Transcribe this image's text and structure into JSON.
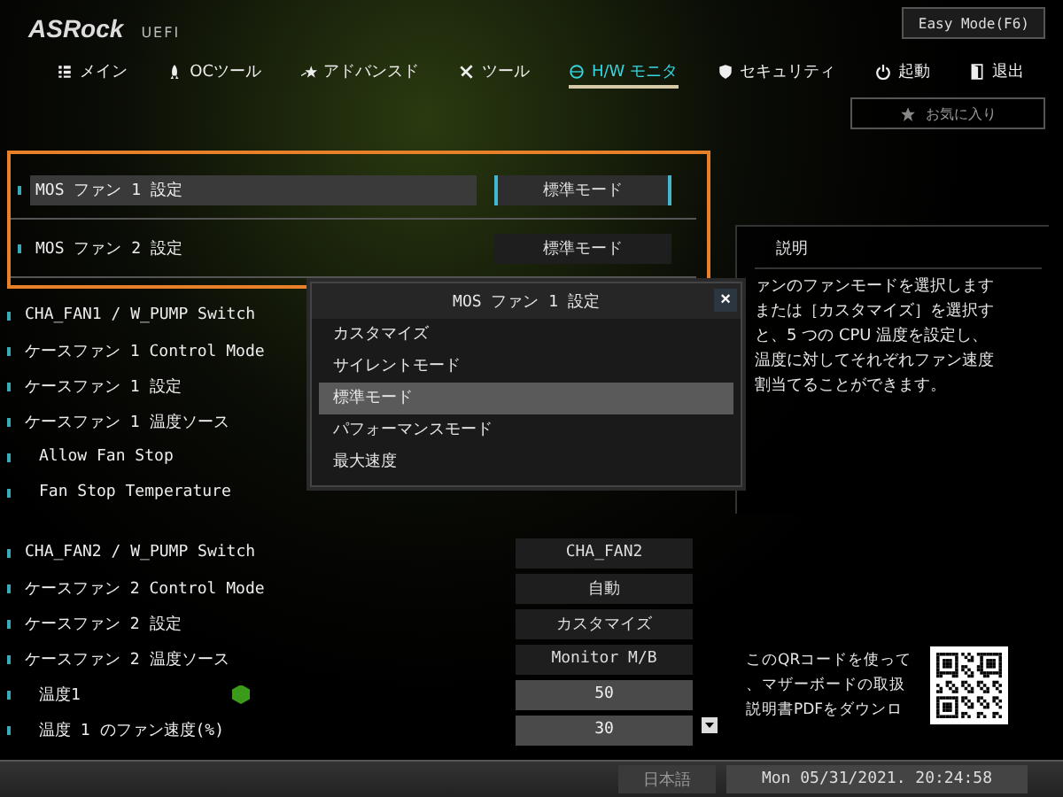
{
  "header": {
    "logo": "ASRock",
    "logo_sub": "UEFI",
    "mode_button": "Easy Mode(F6)"
  },
  "tabs": [
    {
      "label": "メイン",
      "selected": false
    },
    {
      "label": "OCツール",
      "selected": false
    },
    {
      "label": "アドバンスド",
      "selected": false
    },
    {
      "label": "ツール",
      "selected": false
    },
    {
      "label": "H/W モニタ",
      "selected": true
    },
    {
      "label": "セキュリティ",
      "selected": false
    },
    {
      "label": "起動",
      "selected": false
    },
    {
      "label": "退出",
      "selected": false
    }
  ],
  "favorites_button": "お気に入り",
  "highlighted_settings": [
    {
      "label": "MOS ファン 1 設定",
      "value": "標準モード",
      "kind": "option",
      "selected": true
    },
    {
      "label": "MOS ファン 2 設定",
      "value": "標準モード",
      "kind": "option",
      "selected": false
    }
  ],
  "setting_groups": [
    [
      {
        "label": "CHA_FAN1 / W_PUMP Switch"
      },
      {
        "label": "ケースファン 1 Control Mode"
      },
      {
        "label": "ケースファン 1 設定"
      },
      {
        "label": "ケースファン 1 温度ソース",
        "children": [
          {
            "label": "Allow Fan Stop"
          },
          {
            "label": "Fan Stop Temperature"
          }
        ]
      }
    ],
    [
      {
        "label": "CHA_FAN2 / W_PUMP Switch",
        "value": "CHA_FAN2",
        "kind": "option"
      },
      {
        "label": "ケースファン 2 Control Mode",
        "value": "自動",
        "kind": "option"
      },
      {
        "label": "ケースファン 2 設定",
        "value": "カスタマイズ",
        "kind": "option"
      },
      {
        "label": "ケースファン 2 温度ソース",
        "value": "Monitor M/B",
        "kind": "option",
        "children": [
          {
            "label": "温度1",
            "value": "50",
            "kind": "number"
          },
          {
            "label": "温度 1 のファン速度(%)",
            "value": "30",
            "kind": "number"
          }
        ]
      }
    ]
  ],
  "dialog": {
    "title": "MOS ファン 1 設定",
    "close": "×",
    "options": [
      {
        "label": "カスタマイズ",
        "selected": false
      },
      {
        "label": "サイレントモード",
        "selected": false
      },
      {
        "label": "標準モード",
        "selected": true
      },
      {
        "label": "パフォーマンスモード",
        "selected": false
      },
      {
        "label": "最大速度",
        "selected": false
      }
    ]
  },
  "description": {
    "title": "説明",
    "lines": [
      "ァンのファンモードを選択します",
      "または［カスタマイズ］を選択す",
      "と、5 つの CPU 温度を設定し、",
      "温度に対してそれぞれファン速度",
      "割当てることができます。"
    ]
  },
  "qr": {
    "lines": [
      "このQRコードを使って",
      "、マザーボードの取扱",
      "説明書PDFをダウンロ"
    ]
  },
  "status_bar": {
    "language": "日本語",
    "datetime": "Mon 05/31/2021. 20:24:58"
  }
}
